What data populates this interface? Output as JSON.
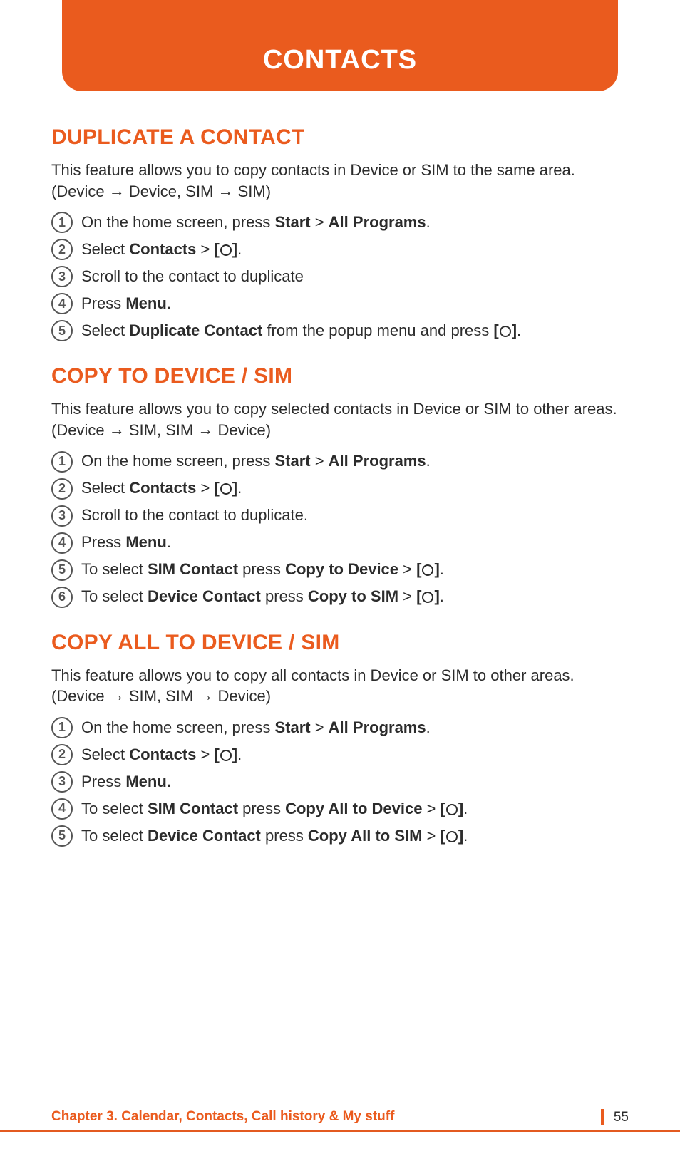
{
  "header": {
    "title": "CONTACTS"
  },
  "sections": [
    {
      "heading": "DUPLICATE A CONTACT",
      "intro_parts": [
        "This feature allows you to copy contacts in Device or SIM to the same area. (Device ",
        "ARROW",
        " Device, SIM ",
        "ARROW",
        " SIM)"
      ],
      "steps": [
        [
          {
            "t": "On the home screen, press "
          },
          {
            "b": "Start"
          },
          {
            "t": " > "
          },
          {
            "b": "All Programs"
          },
          {
            "t": "."
          }
        ],
        [
          {
            "t": "Select "
          },
          {
            "b": "Contacts"
          },
          {
            "t": " > "
          },
          {
            "b": "["
          },
          {
            "circle": true
          },
          {
            "b": "]"
          },
          {
            "t": "."
          }
        ],
        [
          {
            "t": "Scroll to the contact to duplicate"
          }
        ],
        [
          {
            "t": "Press "
          },
          {
            "b": "Menu"
          },
          {
            "t": "."
          }
        ],
        [
          {
            "t": "Select "
          },
          {
            "b": "Duplicate Contact"
          },
          {
            "t": " from the popup menu and press "
          },
          {
            "b": "["
          },
          {
            "circle": true
          },
          {
            "b": "]"
          },
          {
            "t": "."
          }
        ]
      ]
    },
    {
      "heading": "COPY TO DEVICE / SIM",
      "intro_parts": [
        "This feature allows you to copy selected contacts in Device or SIM to other areas. (Device ",
        "ARROW",
        " SIM, SIM ",
        "ARROW",
        " Device)"
      ],
      "steps": [
        [
          {
            "t": "On the home screen, press "
          },
          {
            "b": "Start"
          },
          {
            "t": " > "
          },
          {
            "b": "All Programs"
          },
          {
            "t": "."
          }
        ],
        [
          {
            "t": "Select "
          },
          {
            "b": "Contacts"
          },
          {
            "t": " > "
          },
          {
            "b": "["
          },
          {
            "circle": true
          },
          {
            "b": "]"
          },
          {
            "t": "."
          }
        ],
        [
          {
            "t": "Scroll to the contact to duplicate."
          }
        ],
        [
          {
            "t": "Press "
          },
          {
            "b": "Menu"
          },
          {
            "t": "."
          }
        ],
        [
          {
            "t": "To select "
          },
          {
            "b": "SIM Contact"
          },
          {
            "t": " press "
          },
          {
            "b": "Copy to Device"
          },
          {
            "t": " > "
          },
          {
            "b": "["
          },
          {
            "circle": true
          },
          {
            "b": "]"
          },
          {
            "t": "."
          }
        ],
        [
          {
            "t": "To select "
          },
          {
            "b": "Device Contact"
          },
          {
            "t": " press "
          },
          {
            "b": "Copy to SIM"
          },
          {
            "t": " > "
          },
          {
            "b": "["
          },
          {
            "circle": true
          },
          {
            "b": "]"
          },
          {
            "t": "."
          }
        ]
      ]
    },
    {
      "heading": "COPY ALL TO DEVICE / SIM",
      "intro_parts": [
        "This feature allows you to copy all contacts in Device or SIM to other areas. (Device ",
        "ARROW",
        " SIM, SIM ",
        "ARROW",
        " Device)"
      ],
      "steps": [
        [
          {
            "t": "On the home screen, press "
          },
          {
            "b": "Start"
          },
          {
            "t": " > "
          },
          {
            "b": "All Programs"
          },
          {
            "t": "."
          }
        ],
        [
          {
            "t": "Select "
          },
          {
            "b": "Contacts"
          },
          {
            "t": " > "
          },
          {
            "b": "["
          },
          {
            "circle": true
          },
          {
            "b": "]"
          },
          {
            "t": "."
          }
        ],
        [
          {
            "t": "Press "
          },
          {
            "b": "Menu."
          }
        ],
        [
          {
            "t": "To select "
          },
          {
            "b": "SIM Contact"
          },
          {
            "t": " press "
          },
          {
            "b": "Copy All to Device"
          },
          {
            "t": " > "
          },
          {
            "b": "["
          },
          {
            "circle": true
          },
          {
            "b": "]"
          },
          {
            "t": "."
          }
        ],
        [
          {
            "t": "To select "
          },
          {
            "b": "Device Contact"
          },
          {
            "t": " press "
          },
          {
            "b": "Copy All to SIM"
          },
          {
            "t": " > "
          },
          {
            "b": "["
          },
          {
            "circle": true
          },
          {
            "b": "]"
          },
          {
            "t": "."
          }
        ]
      ]
    }
  ],
  "footer": {
    "chapter": "Chapter 3. Calendar, Contacts, Call history & My stuff",
    "page": "55"
  },
  "glyphs": {
    "arrow": "→"
  }
}
